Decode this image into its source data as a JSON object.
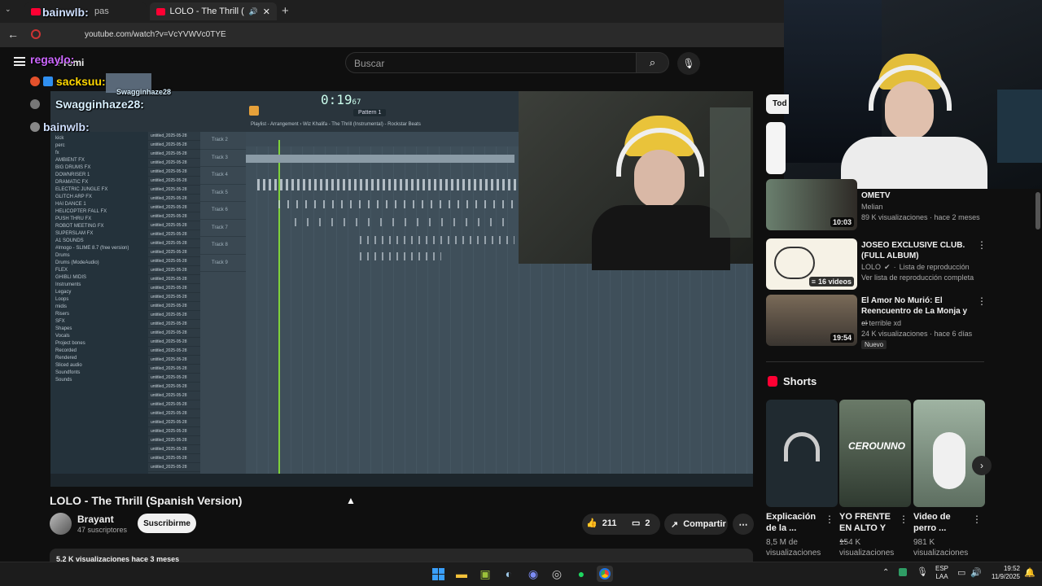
{
  "browser": {
    "tab_active_title": "LOLO - The Thrill (Spanish V",
    "tab_inactive_title": "pas",
    "url": "youtube.com/watch?v=VcYVWVc0TYE"
  },
  "header": {
    "search_placeholder": "Buscar",
    "logo_text": "Premi"
  },
  "chat": [
    {
      "user": "bainwlb:",
      "color": "#cfe0ff"
    },
    {
      "user": "regaylo:",
      "color": "#cc66ff"
    },
    {
      "user": "sacksuu:",
      "color": "#ffd700"
    },
    {
      "user": "Swagginhaze28:",
      "color": "#d8f0ff"
    },
    {
      "user": "bainwlb:",
      "color": "#cfe0ff"
    },
    {
      "user": "Swagginhaze28",
      "color": "#d8f0ff"
    }
  ],
  "fl": {
    "time": "0:19",
    "time_sub": "67",
    "pattern": "Pattern 1",
    "breadcrumb": "Playlist - Arrangement  ›  Wiz Khalifa - The Thrill (Instrumental) - Rockstar Beats",
    "browser_items": [
      "kick",
      "perc",
      "fx",
      "AMBIENT FX",
      "BIG DRUMS FX",
      "DOWNRISER 1",
      "DRAMATIC FX",
      "ELECTRIC JUNGLE FX",
      "GLITCH ARP FX",
      "HAI DANCE 1",
      "HELICOPTER FALL FX",
      "PUSH THRU FX",
      "ROBOT MEETING FX",
      "SUPERSLAM FX",
      "A1 SOUNDS",
      "#Imogo - SLIME 8.7 (free version)",
      "Drums",
      "Drums (ModeAudio)",
      "FLEX",
      "GHIBLI MIDIS",
      "Instruments",
      "Legacy",
      "Loops",
      "midis",
      "Risers",
      "SFX",
      "Shapes",
      "Vocals",
      "Project bones",
      "Recorded",
      "Rendered",
      "Sliced audio",
      "Soundfonts",
      "Sounds"
    ],
    "tracks": [
      "Track 2",
      "Track 3",
      "Track 4",
      "Track 5",
      "Track 6",
      "Track 7",
      "Track 8",
      "Track 9"
    ],
    "channel_label": "untitled_2025-05-28"
  },
  "video": {
    "title": "LOLO - The Thrill (Spanish Version)",
    "channel": "Brayant",
    "subscribers": "47 suscriptores",
    "subscribe_label": "Suscribirme",
    "likes": "211",
    "comments": "2",
    "share_label": "Compartir",
    "views_line": "5,2 K visualizaciones  hace 3 meses"
  },
  "rail": {
    "chip_label": "Tod",
    "items": [
      {
        "title": "OMETV",
        "channel": "Melian",
        "meta": "89 K visualizaciones · hace 2 meses",
        "duration": "10:03"
      },
      {
        "title": "JOSEO EXCLUSIVE CLUB. (FULL ALBUM)",
        "channel": "LOLO",
        "meta": "Lista de reproducción",
        "meta2": "Ver lista de reproducción completa",
        "duration": "16 videos"
      },
      {
        "title": "El Amor No Murió: El Reencuentro de La Monja y ...",
        "channel": "el terrible xd",
        "meta": "24 K visualizaciones · hace 6 días",
        "badge": "Nuevo",
        "duration": "19:54"
      }
    ],
    "shorts_label": "Shorts",
    "shorts": [
      {
        "title": "Explicación de la ...",
        "views": "8,5 M de visualizaciones"
      },
      {
        "title": "YO FRENTE EN ALTO Y ...",
        "views": "154 K visualizaciones",
        "overlay": "CEROUNNO"
      },
      {
        "title": "Video de perro ...",
        "views": "981 K visualizaciones"
      }
    ]
  },
  "taskbar": {
    "lang": "ESP",
    "lang2": "LAA",
    "time": "19:52",
    "date": "11/9/2025"
  },
  "colors": {
    "accent_red": "#ff0033",
    "page_bg": "#0f0f0f"
  }
}
